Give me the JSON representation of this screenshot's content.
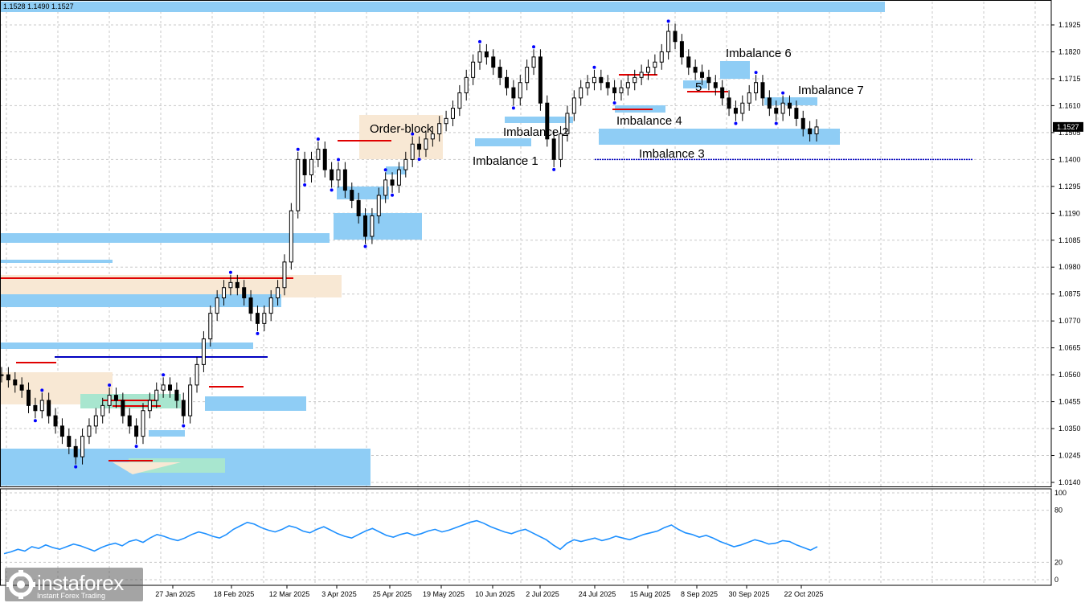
{
  "header": {
    "ohlc": "1.1528 1.1490 1.1527"
  },
  "watermark": {
    "brand": "instaforex",
    "tagline": "Instant Forex Trading",
    "icon": "instaforex-logo-icon"
  },
  "colors": {
    "imbalance": "#8fcdf5",
    "order_block": "#f8e8d4",
    "green_zone": "#a8e6cf",
    "red_level": "#e00000",
    "blue_level": "#0000c0",
    "candle": "#000000",
    "fractal": "#0000ff",
    "indicator": "#1e90ff",
    "grid": "#c8c8c8",
    "current_price_bg": "#000000"
  },
  "chart_data": [
    {
      "type": "line",
      "title": "",
      "xlabel": "",
      "ylabel": "",
      "grid": true,
      "current_price": 1.1527,
      "ylim": [
        1.012,
        1.1985
      ],
      "ytick_labels": [
        "1.1925",
        "1.1820",
        "1.1715",
        "1.1610",
        "1.1505",
        "1.1400",
        "1.1295",
        "1.1190",
        "1.1085",
        "1.0980",
        "1.0875",
        "1.0770",
        "1.0665",
        "1.0560",
        "1.0455",
        "1.0350",
        "1.0245",
        "1.0140"
      ],
      "xtick_labels": [
        "27 Jan 2025",
        "18 Feb 2025",
        "12 Mar 2025",
        "3 Apr 2025",
        "25 Apr 2025",
        "19 May 2025",
        "10 Jun 2025",
        "2 Jul 2025",
        "24 Jul 2025",
        "15 Aug 2025",
        "8 Sep 2025",
        "30 Sep 2025",
        "22 Oct 2025"
      ],
      "annotations": [
        "Order-block",
        "Imbalance 1",
        "Imbalance 2",
        "Imbalance 3",
        "Imbalance 4",
        "5",
        "Imbalance 6",
        "Imbalance 7"
      ],
      "price_series": [
        1.056,
        1.054,
        1.052,
        1.05,
        1.044,
        1.042,
        1.046,
        1.04,
        1.036,
        1.032,
        1.028,
        1.024,
        1.032,
        1.036,
        1.04,
        1.044,
        1.048,
        1.046,
        1.04,
        1.036,
        1.032,
        1.042,
        1.046,
        1.05,
        1.052,
        1.05,
        1.046,
        1.04,
        1.052,
        1.06,
        1.07,
        1.08,
        1.086,
        1.09,
        1.092,
        1.09,
        1.086,
        1.08,
        1.076,
        1.08,
        1.086,
        1.09,
        1.1,
        1.12,
        1.14,
        1.134,
        1.14,
        1.144,
        1.136,
        1.132,
        1.136,
        1.128,
        1.124,
        1.118,
        1.11,
        1.118,
        1.126,
        1.132,
        1.13,
        1.136,
        1.14,
        1.146,
        1.144,
        1.148,
        1.15,
        1.154,
        1.156,
        1.16,
        1.166,
        1.172,
        1.178,
        1.182,
        1.18,
        1.176,
        1.172,
        1.168,
        1.164,
        1.17,
        1.176,
        1.18,
        1.162,
        1.148,
        1.14,
        1.15,
        1.158,
        1.164,
        1.168,
        1.17,
        1.172,
        1.17,
        1.168,
        1.166,
        1.168,
        1.17,
        1.172,
        1.174,
        1.176,
        1.178,
        1.182,
        1.19,
        1.186,
        1.18,
        1.176,
        1.174,
        1.172,
        1.17,
        1.168,
        1.164,
        1.16,
        1.158,
        1.162,
        1.166,
        1.17,
        1.164,
        1.16,
        1.158,
        1.162,
        1.16,
        1.156,
        1.152,
        1.15,
        1.1527
      ],
      "indicator": {
        "ytick_labels": [
          "100",
          "80",
          "20",
          "0"
        ],
        "ylim": [
          0,
          100
        ],
        "values": [
          30,
          32,
          35,
          33,
          38,
          36,
          40,
          37,
          35,
          38,
          41,
          39,
          36,
          33,
          37,
          40,
          42,
          39,
          44,
          46,
          43,
          48,
          52,
          50,
          47,
          45,
          48,
          52,
          55,
          53,
          50,
          48,
          52,
          58,
          62,
          66,
          64,
          60,
          57,
          55,
          58,
          62,
          60,
          56,
          54,
          58,
          61,
          57,
          53,
          50,
          48,
          52,
          56,
          59,
          55,
          51,
          49,
          52,
          54,
          51,
          53,
          56,
          58,
          55,
          57,
          60,
          63,
          66,
          68,
          65,
          61,
          58,
          55,
          53,
          56,
          58,
          54,
          50,
          46,
          40,
          35,
          42,
          46,
          44,
          46,
          48,
          45,
          47,
          50,
          48,
          46,
          49,
          52,
          54,
          56,
          60,
          63,
          58,
          54,
          52,
          49,
          51,
          48,
          44,
          41,
          38,
          40,
          43,
          46,
          44,
          41,
          42,
          45,
          44,
          40,
          37,
          34,
          38
        ]
      }
    }
  ]
}
